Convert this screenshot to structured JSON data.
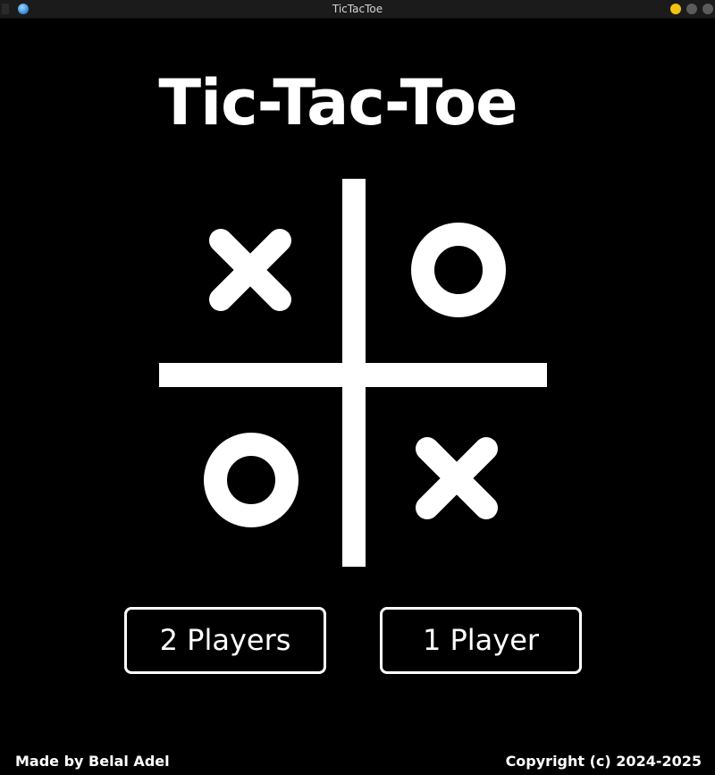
{
  "window": {
    "title": "TicTacToe"
  },
  "game": {
    "title": "Tic-Tac-Toe"
  },
  "logo": {
    "marks": [
      "X",
      "O",
      "O",
      "X"
    ]
  },
  "menu": {
    "two_players_label": "2 Players",
    "one_player_label": "1 Player"
  },
  "footer": {
    "credit": "Made by Belal Adel",
    "copyright": "Copyright (c) 2024-2025"
  },
  "colors": {
    "background": "#000000",
    "foreground": "#ffffff",
    "titlebar": "#1b1b1b",
    "minimize_button": "#f5c211"
  }
}
